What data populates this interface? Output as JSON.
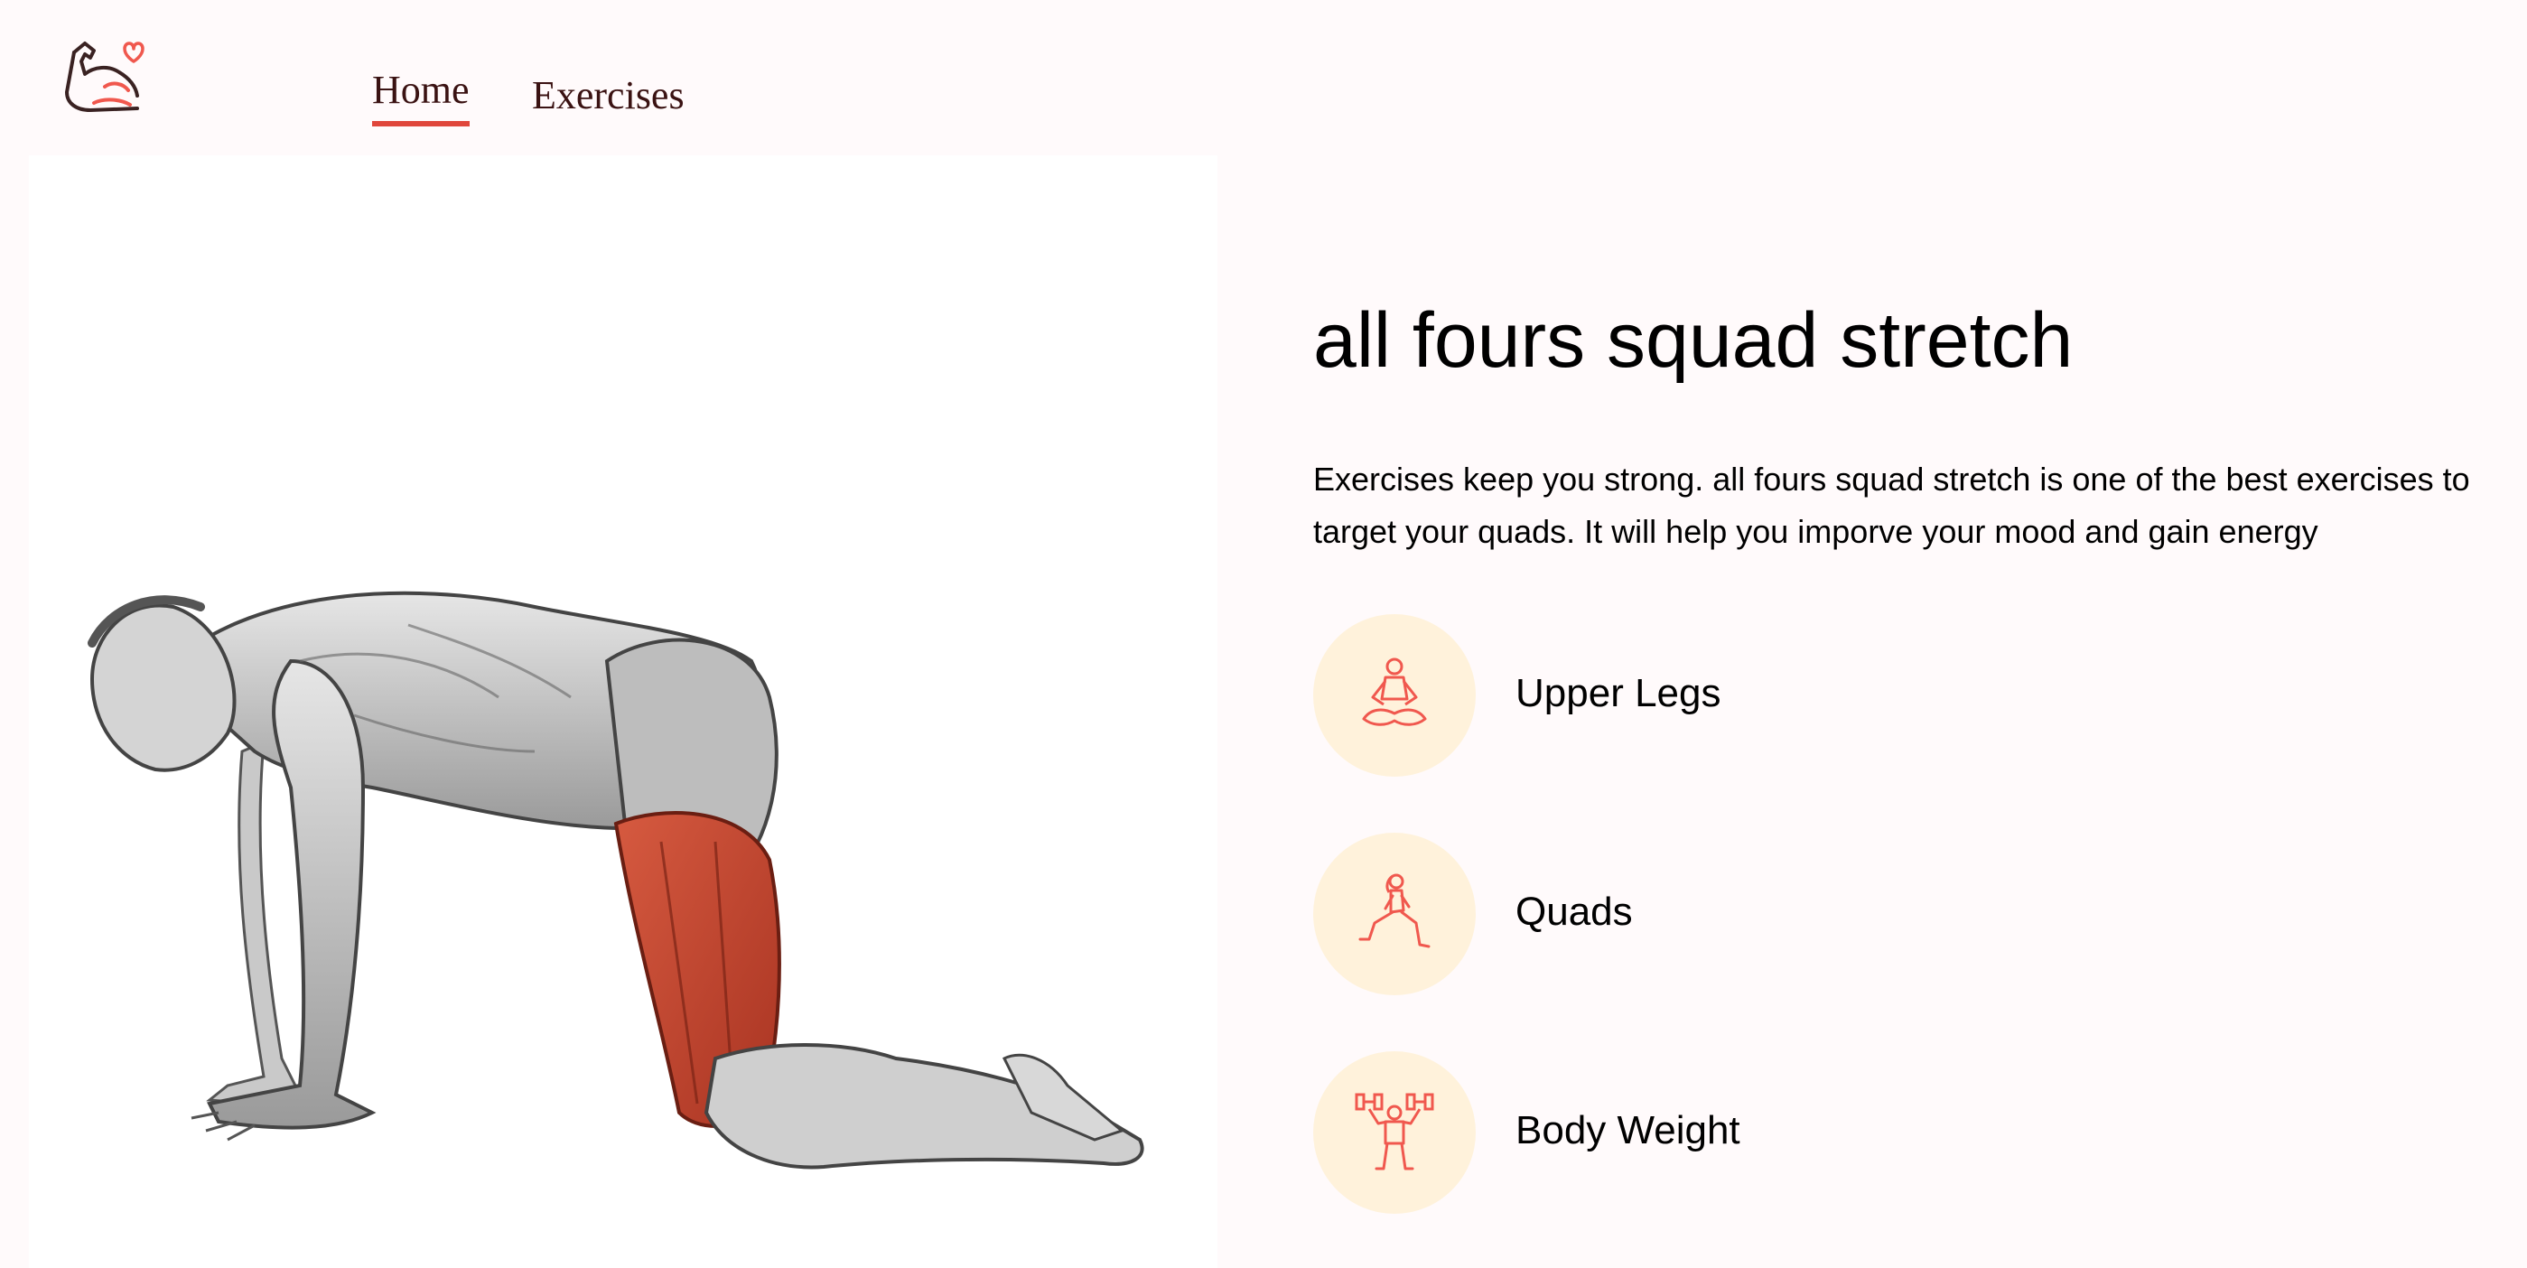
{
  "nav": {
    "logo_icon": "flexed-arm-heart-icon",
    "links": [
      {
        "label": "Home",
        "active": true
      },
      {
        "label": "Exercises",
        "active": false
      }
    ]
  },
  "exercise": {
    "image_icon": "anatomy-figure-all-fours-quads-highlighted",
    "name": "all fours squad stretch",
    "description": "Exercises keep you strong. all fours squad stretch is one of the best exercises to target your quads. It will help you imporve your mood and gain energy",
    "details": [
      {
        "label": "Upper Legs",
        "icon": "meditation-person-icon"
      },
      {
        "label": "Quads",
        "icon": "lunge-person-icon"
      },
      {
        "label": "Body Weight",
        "icon": "dumbbell-lifter-icon"
      }
    ]
  },
  "colors": {
    "accent": "#E0463B",
    "icon_stroke": "#F0584E",
    "circle_bg": "#FFF2DB",
    "page_bg": "#FFFAFB",
    "muscle_highlight": "#C8452F"
  }
}
